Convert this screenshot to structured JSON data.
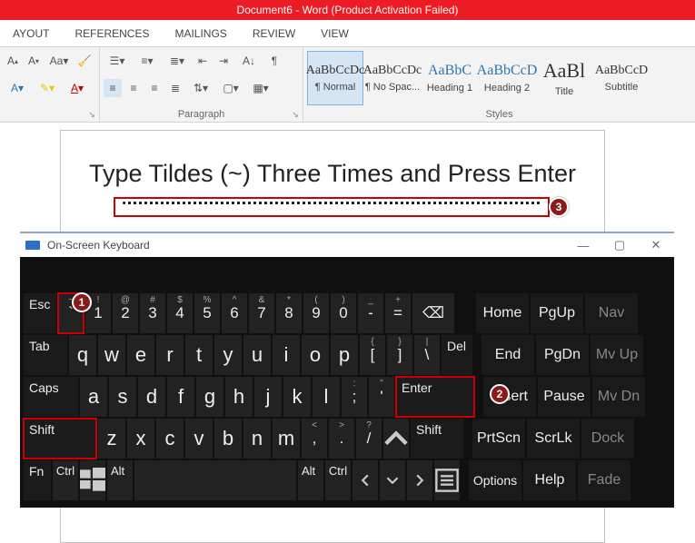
{
  "titlebar": {
    "text": "Document6 -  Word (Product Activation Failed)"
  },
  "ribbon_tabs": [
    "AYOUT",
    "REFERENCES",
    "MAILINGS",
    "REVIEW",
    "VIEW"
  ],
  "paragraph_group": {
    "label": "Paragraph"
  },
  "styles_group": {
    "label": "Styles",
    "items": [
      {
        "preview": "AaBbCcDc",
        "name": "¶ Normal",
        "selected": true
      },
      {
        "preview": "AaBbCcDc",
        "name": "¶ No Spac..."
      },
      {
        "preview": "AaBbC",
        "name": "Heading 1",
        "cls": "med"
      },
      {
        "preview": "AaBbCcD",
        "name": "Heading 2",
        "cls": "med"
      },
      {
        "preview": "AaBl",
        "name": "Title",
        "cls": "big"
      },
      {
        "preview": "AaBbCcD",
        "name": "Subtitle"
      }
    ]
  },
  "document": {
    "heading": "Type Tildes (~) Three Times and Press Enter"
  },
  "osk": {
    "title": "On-Screen Keyboard",
    "rows": {
      "num": [
        {
          "label": "`",
          "sub": "~"
        },
        {
          "label": "1",
          "sub": "!"
        },
        {
          "label": "2",
          "sub": "@"
        },
        {
          "label": "3",
          "sub": "#"
        },
        {
          "label": "4",
          "sub": "$"
        },
        {
          "label": "5",
          "sub": "%"
        },
        {
          "label": "6",
          "sub": "^"
        },
        {
          "label": "7",
          "sub": "&"
        },
        {
          "label": "8",
          "sub": "*"
        },
        {
          "label": "9",
          "sub": "("
        },
        {
          "label": "0",
          "sub": ")"
        },
        {
          "label": "-",
          "sub": "_"
        },
        {
          "label": "=",
          "sub": "+"
        }
      ],
      "q": [
        "q",
        "w",
        "e",
        "r",
        "t",
        "y",
        "u",
        "i",
        "o",
        "p"
      ],
      "q_sym": [
        {
          "label": "[",
          "sub": "{"
        },
        {
          "label": "]",
          "sub": "}"
        },
        {
          "label": "\\",
          "sub": "|"
        }
      ],
      "a": [
        "a",
        "s",
        "d",
        "f",
        "g",
        "h",
        "j",
        "k",
        "l"
      ],
      "a_sym": [
        {
          "label": ";",
          "sub": ":"
        },
        {
          "label": "'",
          "sub": "\""
        }
      ],
      "z": [
        "z",
        "x",
        "c",
        "v",
        "b",
        "n",
        "m"
      ],
      "z_sym": [
        {
          "label": ",",
          "sub": "<"
        },
        {
          "label": ".",
          "sub": ">"
        },
        {
          "label": "/",
          "sub": "?"
        }
      ]
    },
    "func": {
      "esc": "Esc",
      "tab": "Tab",
      "caps": "Caps",
      "shift": "Shift",
      "fn": "Fn",
      "ctrl": "Ctrl",
      "alt": "Alt",
      "bksp": "⌫",
      "del": "Del",
      "enter": "Enter",
      "shift2": "Shift"
    },
    "side": [
      [
        "Home",
        "PgUp",
        "Nav"
      ],
      [
        "End",
        "PgDn",
        "Mv Up"
      ],
      [
        "Insert",
        "Pause",
        "Mv Dn"
      ],
      [
        "PrtScn",
        "ScrLk",
        "Dock"
      ],
      [
        "Options",
        "Help",
        "Fade"
      ]
    ]
  },
  "badges": {
    "b1": "1",
    "b2": "2",
    "b3": "3"
  }
}
